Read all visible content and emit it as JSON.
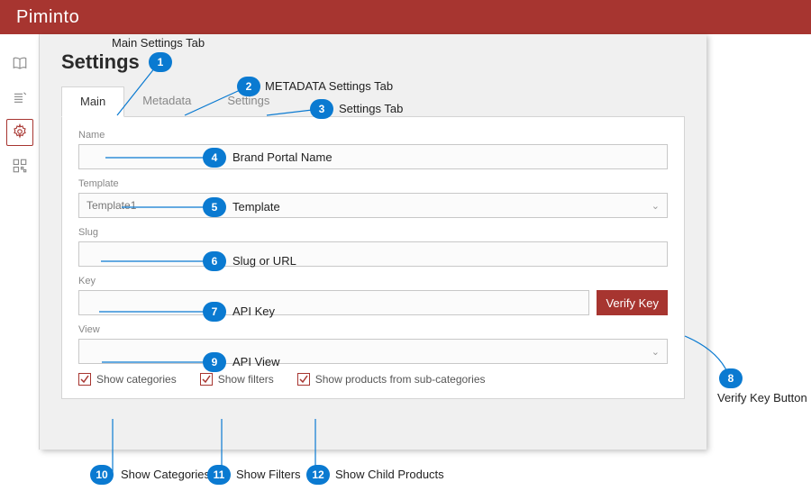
{
  "header": {
    "logo": "Piminto"
  },
  "page": {
    "title": "Settings"
  },
  "tabs": [
    {
      "label": "Main",
      "active": true
    },
    {
      "label": "Metadata",
      "active": false
    },
    {
      "label": "Settings",
      "active": false
    }
  ],
  "fields": {
    "name": {
      "label": "Name",
      "value": ""
    },
    "template": {
      "label": "Template",
      "value": "Template1"
    },
    "slug": {
      "label": "Slug",
      "value": ""
    },
    "key": {
      "label": "Key",
      "value": "",
      "button": "Verify Key"
    },
    "view": {
      "label": "View",
      "value": ""
    }
  },
  "checks": [
    {
      "label": "Show categories",
      "checked": true
    },
    {
      "label": "Show filters",
      "checked": true
    },
    {
      "label": "Show products from sub-categories",
      "checked": true
    }
  ],
  "annotations": [
    {
      "num": "1",
      "text": "Main Settings Tab"
    },
    {
      "num": "2",
      "text": "METADATA Settings Tab"
    },
    {
      "num": "3",
      "text": "Settings Tab"
    },
    {
      "num": "4",
      "text": "Brand Portal Name"
    },
    {
      "num": "5",
      "text": "Template"
    },
    {
      "num": "6",
      "text": "Slug or URL"
    },
    {
      "num": "7",
      "text": "API Key"
    },
    {
      "num": "8",
      "text": "Verify Key Button"
    },
    {
      "num": "9",
      "text": "API View"
    },
    {
      "num": "10",
      "text": "Show Categories"
    },
    {
      "num": "11",
      "text": "Show Filters"
    },
    {
      "num": "12",
      "text": "Show Child Products"
    }
  ],
  "colors": {
    "brand": "#a73530",
    "accent": "#0a7ad1"
  }
}
